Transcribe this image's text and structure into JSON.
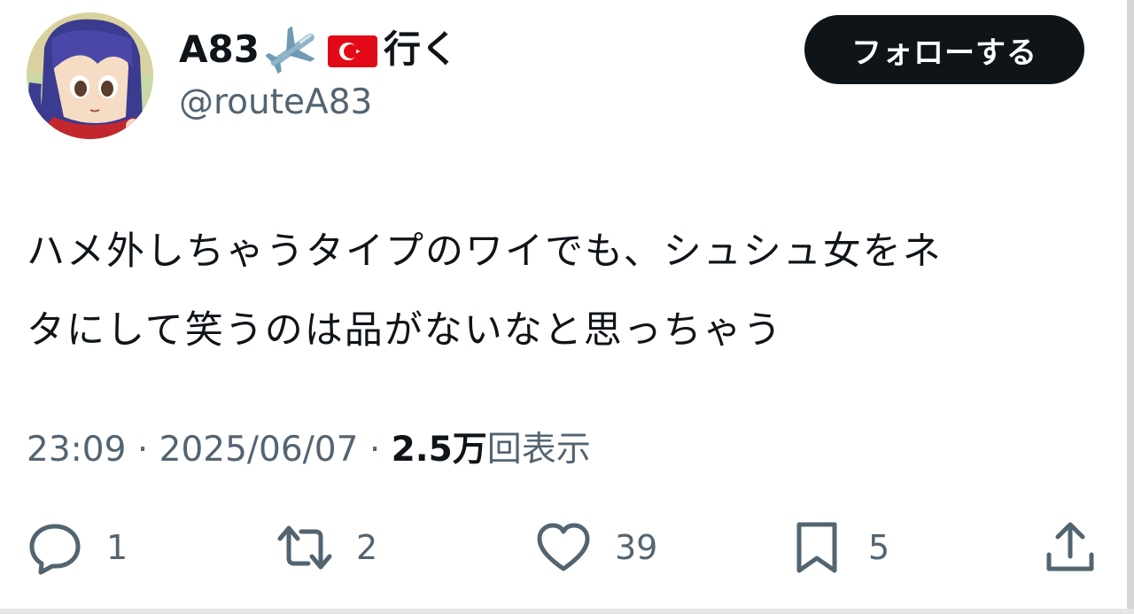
{
  "user": {
    "display_name": "A83",
    "display_suffix": "行く",
    "name_emojis": [
      "airplane-icon",
      "turkey-flag-icon"
    ],
    "handle": "@routeA83"
  },
  "follow_button": {
    "label": "フォローする"
  },
  "tweet": {
    "line1": "ハメ外しちゃうタイプのワイでも、シュシュ女をネ",
    "line2": "タにして笑うのは品がないなと思っちゃう"
  },
  "meta": {
    "time": "23:09",
    "separator": "·",
    "date": "2025/06/07",
    "views_count": "2.5万",
    "views_label": "回表示"
  },
  "actions": {
    "reply_count": "1",
    "retweet_count": "2",
    "like_count": "39",
    "bookmark_count": "5"
  },
  "colors": {
    "text_primary": "#0f1419",
    "text_secondary": "#536471",
    "button_bg": "#0f1419",
    "flag_red": "#e30a17"
  }
}
